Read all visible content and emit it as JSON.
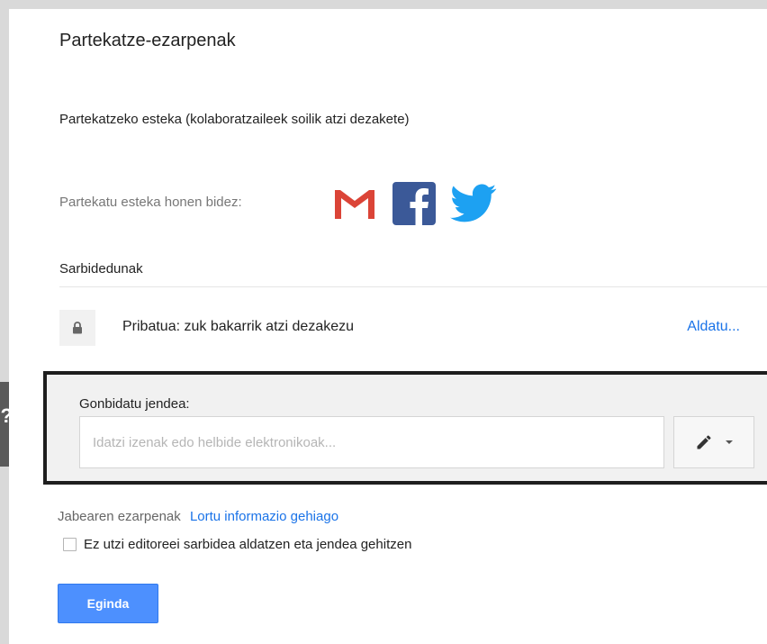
{
  "dialog": {
    "title": "Partekatze-ezarpenak",
    "link_label": "Partekatzeko esteka (kolaboratzaileek soilik atzi dezakete)",
    "share_via_label": "Partekatu esteka honen bidez:",
    "share_icons": [
      "gmail-icon",
      "facebook-icon",
      "twitter-icon"
    ]
  },
  "access": {
    "section_label": "Sarbidedunak",
    "status_text": "Pribatua: zuk bakarrik atzi dezakezu",
    "change_link": "Aldatu..."
  },
  "invite": {
    "label": "Gonbidatu jendea:",
    "input_value": "",
    "input_placeholder": "Idatzi izenak edo helbide elektronikoak...",
    "permission_icon": "pencil-icon"
  },
  "callout": {
    "text": "?"
  },
  "owner": {
    "label": "Jabearen ezarpenak",
    "link": "Lortu informazio gehiago",
    "checkbox_label": "Ez utzi editoreei sarbidea aldatzen eta jendea gehitzen",
    "checkbox_checked": false
  },
  "footer": {
    "done_label": "Eginda"
  },
  "colors": {
    "accent": "#1a73e8",
    "primary_button": "#4d90fe",
    "gmail_red": "#db4437",
    "facebook_blue": "#3b5998",
    "twitter_blue": "#1da1f2",
    "highlight_border": "#1e1e1e",
    "callout": "#5a5a5a"
  }
}
